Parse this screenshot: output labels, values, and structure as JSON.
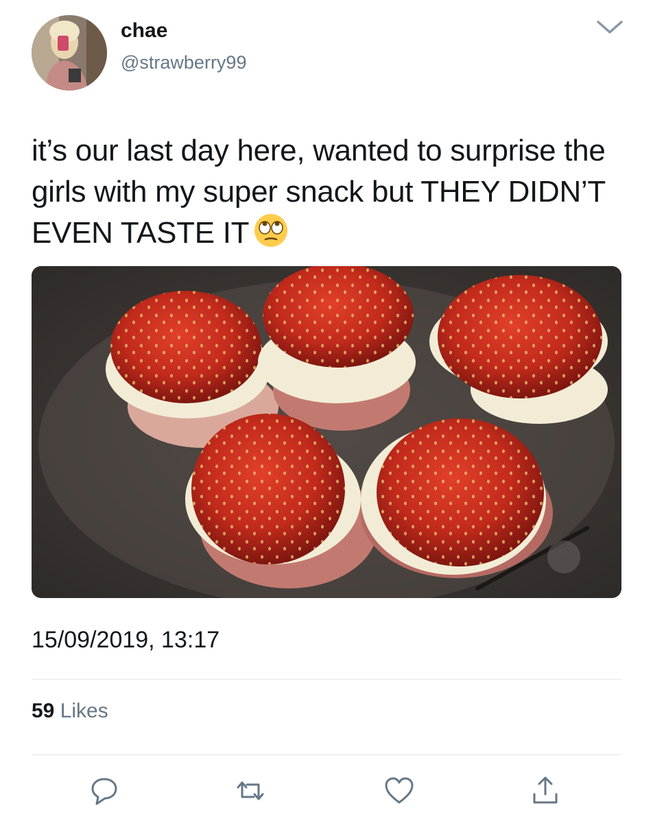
{
  "user": {
    "display_name": "chae",
    "handle": "@strawberry99"
  },
  "tweet": {
    "text": "it’s our last day here, wanted to surprise the girls with my super snack but THEY DIDN’T EVEN TASTE IT",
    "emoji": "face-with-rolling-eyes",
    "timestamp": "15/09/2019, 13:17",
    "likes_count": "59",
    "likes_label": " Likes"
  },
  "actions": [
    {
      "name": "reply-icon"
    },
    {
      "name": "retweet-icon"
    },
    {
      "name": "like-icon"
    },
    {
      "name": "share-icon"
    }
  ],
  "colors": {
    "text_primary": "#14171a",
    "text_secondary": "#657786",
    "icon": "#657786",
    "divider": "#e1e8ed"
  }
}
